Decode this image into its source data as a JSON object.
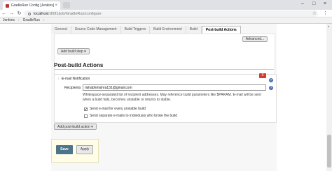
{
  "browser": {
    "tab_title": "GradleRun Config [Jenkins]",
    "tab_close": "×",
    "url_host": "localhost",
    "url_path": ":8081/job/GradleRun/configure",
    "nav": {
      "back": "←",
      "forward": "→",
      "reload": "↻"
    },
    "star": "☆",
    "menu": "⋮",
    "window_controls": {
      "minimize": "–",
      "maximize": "□",
      "close": "×"
    }
  },
  "breadcrumbs": [
    "Jenkins",
    "GradleRun"
  ],
  "breadcrumb_separator": "›",
  "config_tabs": [
    "General",
    "Source Code Management",
    "Build Triggers",
    "Build Environment",
    "Build",
    "Post-build Actions"
  ],
  "active_tab_index": 5,
  "build": {
    "advanced_label": "Advanced...",
    "add_build_step_label": "Add build step ▾"
  },
  "post_build": {
    "section_title": "Post-build Actions",
    "add_action_label": "Add post-build action ▾"
  },
  "email_notification": {
    "heading": "E-mail Notification",
    "delete_label": "X",
    "recipients_label": "Recipients",
    "recipients_value": "rishabhmishra131@gmail.com",
    "description": "Whitespace-separated list of recipient addresses. May reference build parameters like $PARAM. E-mail will be sent when a build fails, becomes unstable or returns to stable.",
    "checkbox_unstable": {
      "label": "Send e-mail for every unstable build",
      "checked": true
    },
    "checkbox_individuals": {
      "label": "Send separate e-mails to individuals who broke the build",
      "checked": false
    }
  },
  "actions": {
    "save_label": "Save",
    "apply_label": "Apply"
  },
  "colors": {
    "save_button": "#4b758b",
    "delete_button": "#d43a2f",
    "help_icon": "#4a6fb5",
    "savebar_bg": "#fffde7"
  },
  "help_glyph": "?"
}
